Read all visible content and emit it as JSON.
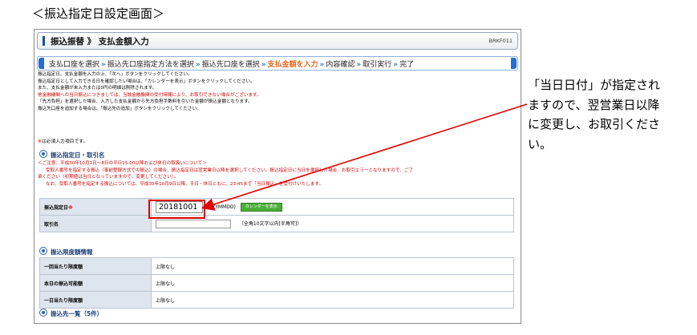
{
  "heading": "＜振込指定日設定画面＞",
  "screen": {
    "title": "振込振替 》 支払金額入力",
    "code": "BRKF011",
    "steps": [
      {
        "label": "支払口座を選択",
        "active": false
      },
      {
        "label": "振込先口座指定方法を選択",
        "active": false
      },
      {
        "label": "振込先口座を選択",
        "active": false
      },
      {
        "label": "支払金額を入力",
        "active": true
      },
      {
        "label": "内容確認",
        "active": false
      },
      {
        "label": "取引実行",
        "active": false
      },
      {
        "label": "完了",
        "active": false
      }
    ],
    "step_separator": "»",
    "notes": [
      {
        "text": "振込指定日、支払金額を入力の上、「次へ」ボタンをクリックしてください。",
        "red": false
      },
      {
        "text": "振込指定日として入力できる日を確認したい場合は、「カレンダーを表示」ボタンをクリックしてください。",
        "red": false
      },
      {
        "text": "また、支払金額が未入力または0円の明細は削除されます。",
        "red": false
      },
      {
        "text": "他金融機関への当日振込につきましては、当該金融機関の受付時間により、お取引できない場合がございます。",
        "red": true
      },
      {
        "text": "「先方負担」を選択した場合、入力した支払金額から先方負担手数料を引いた金額が振込金額となります。",
        "red": false
      },
      {
        "text": "振込先口座を追加する場合は、「振込先の追加」ボタンをクリックしてください。",
        "red": false
      }
    ],
    "required_mark": "※",
    "required_note": "は必須入力項目です。",
    "section1_title": "振込指定日・取引名",
    "caution_lines": [
      "＜ご注意：平成30年10月1日～8日の平日15:00以降および休日の取扱いについて＞",
      "受取人番号を指定する振込（事前登録方式での振込）の場合、振込指定日は翌営業日以降を選択してください。振込指定日に当日を選択した場合、お取引エラーとなりますので、ご了",
      "承ください（初期値は当日となっていますので、変更してください）。",
      "なお、受取人番号を指定する振込については、平成30年10月9日以降、平日・休日ともに、23:45まで「当日振込」を受付けいたします。"
    ],
    "date_label": "振込指定日",
    "date_value": "20181001",
    "date_format": "(YYYYMMDD)",
    "calendar_button": "カレンダーを表示",
    "name_label": "取引名",
    "name_hint": "（全角10文字以内[半角可]）",
    "section2_title": "振込限度額情報",
    "limits": [
      {
        "label": "一回当たり限度額",
        "value": "上限なし"
      },
      {
        "label": "本日の振込可能額",
        "value": "上限なし"
      },
      {
        "label": "一日当たり限度額",
        "value": "上限なし"
      }
    ],
    "section3_title": "振込先一覧（5件）"
  },
  "callout": {
    "lines": [
      "「当日日付」が指定され",
      "ますので、翌営業日以降",
      "に変更し、お取引くださ",
      "い。"
    ],
    "color": "#e00000"
  }
}
